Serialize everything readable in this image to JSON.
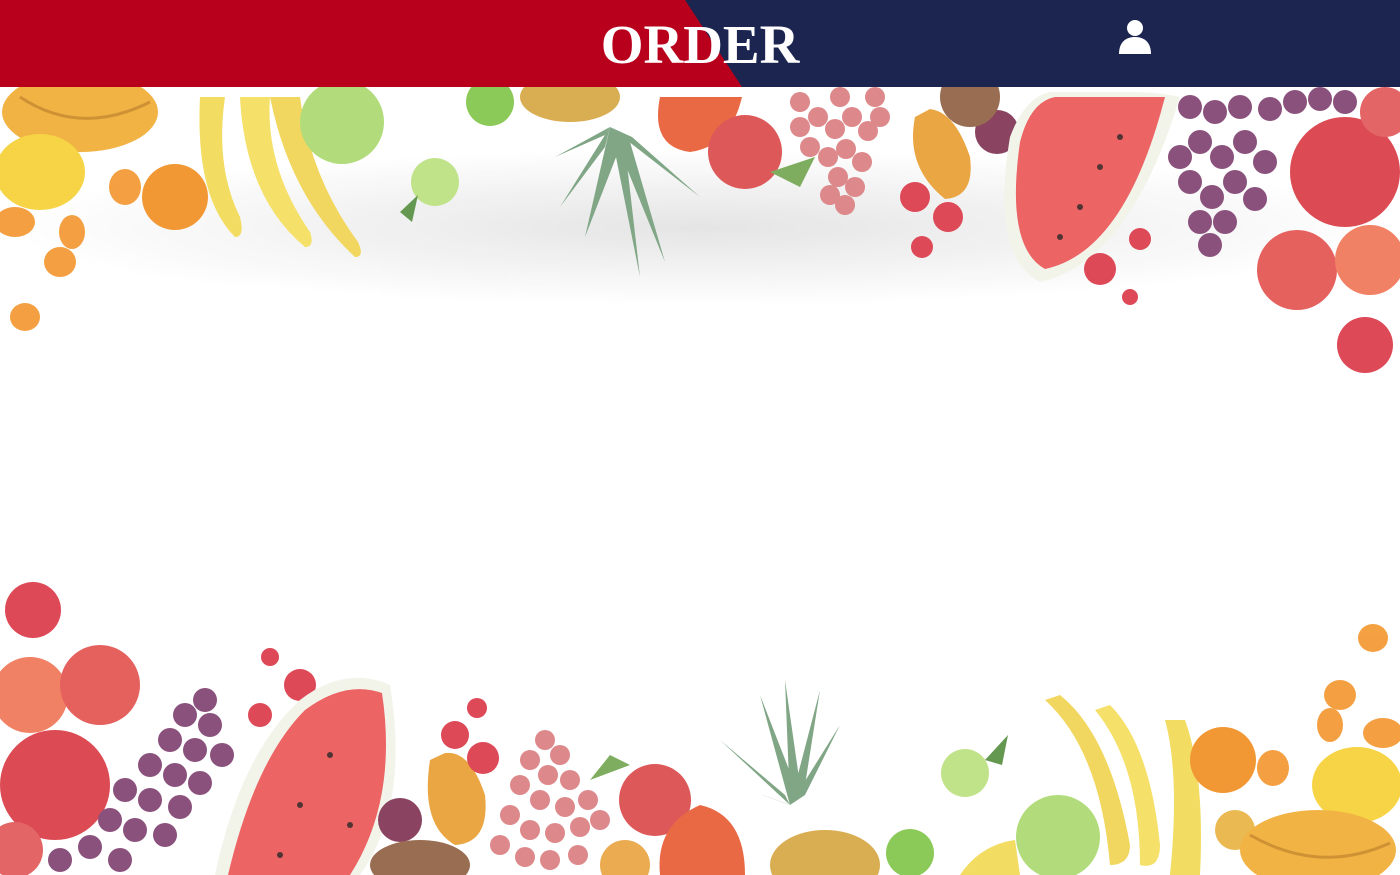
{
  "header": {
    "title": "ORDER",
    "account_icon": "user-icon",
    "colors": {
      "left_panel": "#b8001c",
      "right_panel": "#1b2550",
      "title_text": "#ffffff"
    }
  },
  "background": {
    "image": "fruit-border-decoration",
    "colors": {
      "page": "#ffffff"
    }
  }
}
